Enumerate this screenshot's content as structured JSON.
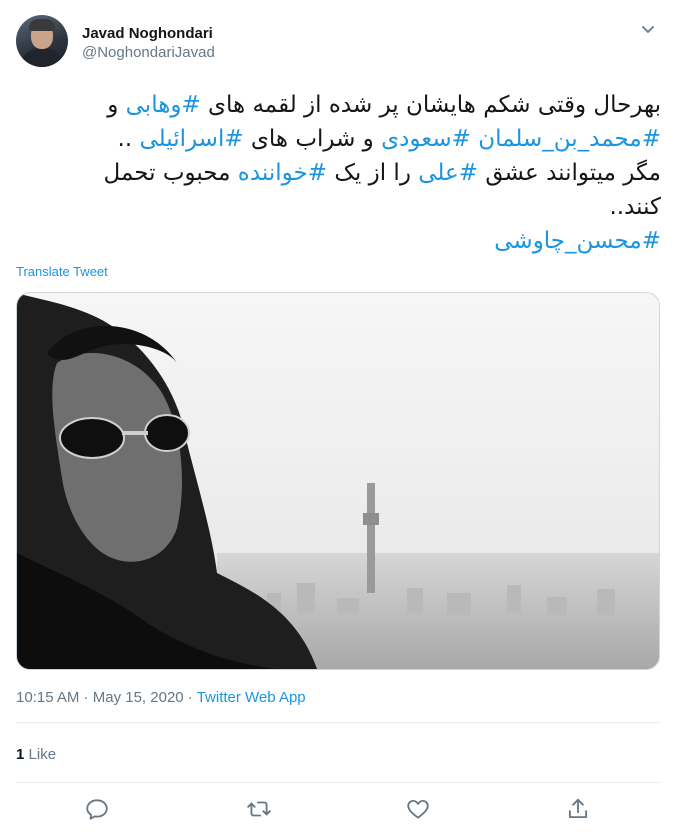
{
  "author": {
    "name": "Javad Noghondari",
    "handle": "@NoghondariJavad"
  },
  "tweet": {
    "line1_pre": "بهرحال وقتی شکم هایشان پر شده از لقمه های ",
    "tag1": "#وهابی",
    "line1_post": " و",
    "tag2": "#محمد_بن_سلمان",
    "sep1": " ",
    "tag3": "#سعودی",
    "mid1": " و شراب های ",
    "tag4": "#اسرائیلی",
    "line2_post": " ..",
    "line3_pre": "مگر میتوانند عشق ",
    "tag5": "#علی",
    "mid2": " را از یک ",
    "tag6": "#خواننده",
    "line3_post": " محبوب تحمل",
    "line4": "کنند..",
    "tag7": "#محسن_چاوشی"
  },
  "translate_label": "Translate Tweet",
  "meta": {
    "time": "10:15 AM",
    "dot1": " · ",
    "date": "May 15, 2020",
    "dot2": " · ",
    "app": "Twitter Web App"
  },
  "likes": {
    "count": "1",
    "label": "Like"
  },
  "colors": {
    "link": "#1b95e0",
    "secondary": "#657786",
    "divider": "#e6ecf0"
  },
  "icons": [
    "chevron-down-icon",
    "reply-icon",
    "retweet-icon",
    "like-icon",
    "share-icon"
  ]
}
